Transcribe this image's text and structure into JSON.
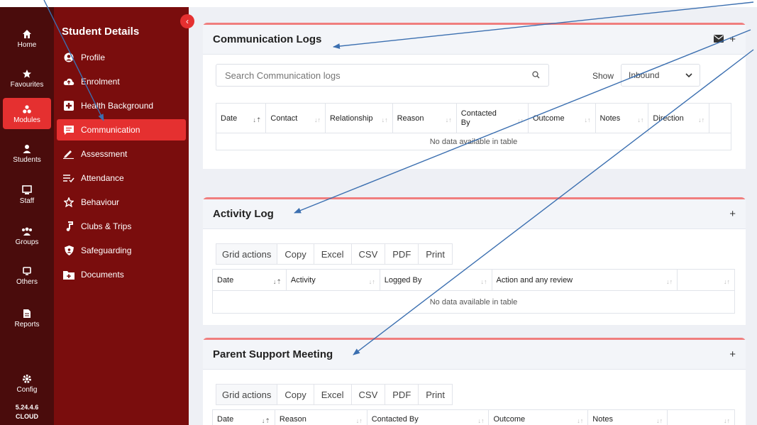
{
  "rail": {
    "items": [
      {
        "label": "Home",
        "icon": "home-icon"
      },
      {
        "label": "Favourites",
        "icon": "star-icon"
      },
      {
        "label": "Modules",
        "icon": "modules-icon"
      },
      {
        "label": "Students",
        "icon": "student-icon"
      },
      {
        "label": "Staff",
        "icon": "staff-icon"
      },
      {
        "label": "Groups",
        "icon": "groups-icon"
      },
      {
        "label": "Others",
        "icon": "others-icon"
      },
      {
        "label": "Reports",
        "icon": "reports-icon"
      },
      {
        "label": "Config",
        "icon": "gear-icon"
      }
    ],
    "version": "5.24.4.6",
    "edition": "CLOUD"
  },
  "sidebar": {
    "title": "Student Details",
    "collapse": "‹",
    "items": [
      {
        "label": "Profile"
      },
      {
        "label": "Enrolment"
      },
      {
        "label": "Health Background"
      },
      {
        "label": "Communication"
      },
      {
        "label": "Assessment"
      },
      {
        "label": "Attendance"
      },
      {
        "label": "Behaviour"
      },
      {
        "label": "Clubs & Trips"
      },
      {
        "label": "Safeguarding"
      },
      {
        "label": "Documents"
      }
    ]
  },
  "communication": {
    "title": "Communication Logs",
    "search_placeholder": "Search Communication logs",
    "show_label": "Show",
    "show_value": "Inbound",
    "columns": [
      "Date",
      "Contact",
      "Relationship",
      "Reason",
      "Contacted By",
      "Outcome",
      "Notes",
      "Direction",
      ""
    ],
    "empty": "No data available in table",
    "plus": "+"
  },
  "activity": {
    "title": "Activity Log",
    "plus": "+",
    "grid_actions": "Grid actions",
    "buttons": [
      "Copy",
      "Excel",
      "CSV",
      "PDF",
      "Print"
    ],
    "columns": [
      "Date",
      "Activity",
      "Logged By",
      "Action and any review",
      ""
    ],
    "empty": "No data available in table"
  },
  "parent": {
    "title": "Parent Support Meeting",
    "plus": "+",
    "grid_actions": "Grid actions",
    "buttons": [
      "Copy",
      "Excel",
      "CSV",
      "PDF",
      "Print"
    ],
    "columns": [
      "Date",
      "Reason",
      "Contacted By",
      "Outcome",
      "Notes",
      ""
    ]
  },
  "colors": {
    "rail": "#4a0c0c",
    "sidebar": "#7a0d0d",
    "accent": "#e53030",
    "panel_border": "#f07e7e",
    "arrow": "#3b6fb0"
  }
}
